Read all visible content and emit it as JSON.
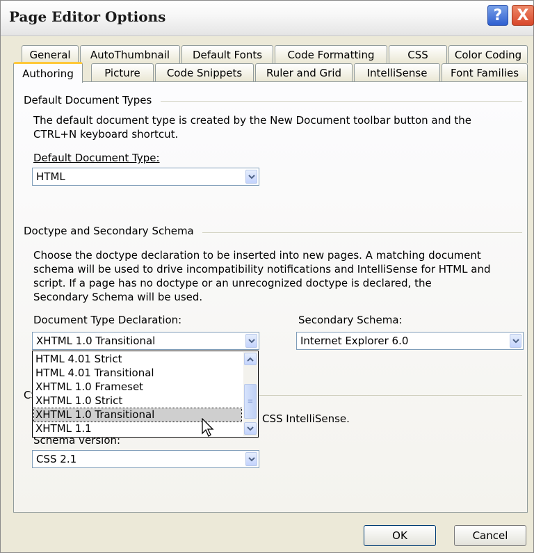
{
  "window": {
    "title": "Page Editor Options"
  },
  "titlebar": {
    "help_glyph": "?",
    "close_glyph": "X"
  },
  "tabs_back": [
    "General",
    "AutoThumbnail",
    "Default Fonts",
    "Code Formatting",
    "CSS",
    "Color Coding"
  ],
  "tabs_front": [
    "Authoring",
    "Picture",
    "Code Snippets",
    "Ruler and Grid",
    "IntelliSense",
    "Font Families"
  ],
  "active_tab": "Authoring",
  "default_doc": {
    "group": "Default Document Types",
    "desc1": "The default document type is created by the New Document toolbar button and the",
    "desc2": "CTRL+N keyboard shortcut.",
    "label": "Default Document Type:",
    "value": "HTML"
  },
  "doctype": {
    "group": "Doctype and Secondary Schema",
    "desc1": "Choose the doctype declaration to be inserted into new pages. A matching document",
    "desc2": "schema will be used to drive incompatibility notifications and IntelliSense for HTML and",
    "desc3": "script. If a page has no doctype or an unrecognized doctype is declared, the",
    "desc4": "Secondary Schema will be used.",
    "decl_label": "Document Type Declaration:",
    "decl_value": "XHTML 1.0 Transitional",
    "schema_label": "Secondary Schema:",
    "schema_value": "Internet Explorer 6.0",
    "options": [
      "HTML 4.01 Strict",
      "HTML 4.01 Transitional",
      "XHTML 1.0 Frameset",
      "XHTML 1.0 Strict",
      "XHTML 1.0 Transitional",
      "XHTML 1.1"
    ],
    "selected_option": "XHTML 1.0 Transitional"
  },
  "css": {
    "group_partial": "CS",
    "desc_partial": "CSS IntelliSense.",
    "label": "Schema version:",
    "value": "CSS 2.1"
  },
  "buttons": {
    "ok": "OK",
    "cancel": "Cancel"
  }
}
